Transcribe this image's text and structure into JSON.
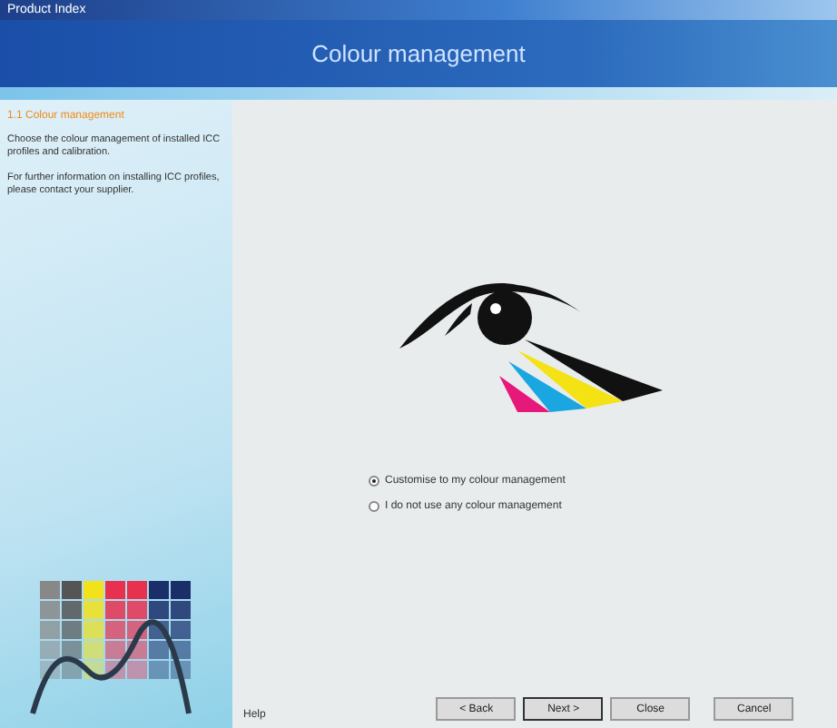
{
  "window": {
    "title": "Product Index"
  },
  "header": {
    "title": "Colour management"
  },
  "sidebar": {
    "heading": "1.1 Colour management",
    "paragraphs": [
      "Choose the colour management of installed ICC profiles and calibration.",
      "For further information on installing ICC profiles, please contact your supplier."
    ]
  },
  "options": [
    {
      "label": "Customise to my colour management",
      "selected": true
    },
    {
      "label": "I do not use any colour management",
      "selected": false
    }
  ],
  "help": "Help",
  "buttons": [
    {
      "label": "< Back",
      "default": false
    },
    {
      "label": "Next >",
      "default": true
    },
    {
      "label": "Close",
      "default": false
    },
    {
      "label": "Cancel",
      "default": false
    }
  ]
}
